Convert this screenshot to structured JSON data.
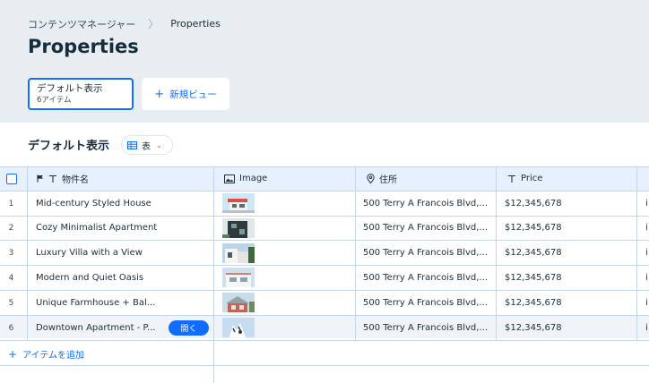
{
  "breadcrumb": {
    "parent": "コンテンツマネージャー",
    "separator": "〉",
    "current": "Properties"
  },
  "page_title": "Properties",
  "views": {
    "active_name": "デフォルト表示",
    "active_count": "6アイテム",
    "new_view": "新規ビュー"
  },
  "section": {
    "title": "デフォルト表示",
    "layout_label": "表"
  },
  "columns": {
    "title": "物件名",
    "image": "Image",
    "address": "住所",
    "price": "Price",
    "next_partial": ""
  },
  "rows": [
    {
      "num": "1",
      "title": "Mid-century Styled House",
      "address": "500 Terry A Francois Blvd,...",
      "price": "$12,345,678",
      "extra": "i"
    },
    {
      "num": "2",
      "title": "Cozy Minimalist Apartment",
      "address": "500 Terry A Francois Blvd,...",
      "price": "$12,345,678",
      "extra": "i"
    },
    {
      "num": "3",
      "title": "Luxury Villa with a View",
      "address": "500 Terry A Francois Blvd,...",
      "price": "$12,345,678",
      "extra": "i"
    },
    {
      "num": "4",
      "title": "Modern and Quiet Oasis",
      "address": "500 Terry A Francois Blvd,...",
      "price": "$12,345,678",
      "extra": "i"
    },
    {
      "num": "5",
      "title": "Unique Farmhouse + Bal...",
      "address": "500 Terry A Francois Blvd,...",
      "price": "$12,345,678",
      "extra": "i"
    },
    {
      "num": "6",
      "title": "Downtown Apartment - P...",
      "address": "500 Terry A Francois Blvd,...",
      "price": "$12,345,678",
      "extra": "i"
    }
  ],
  "open_button": "開く",
  "add_item": "アイテムを追加",
  "colors": {
    "accent": "#116dff",
    "header_bg": "#e8edf2",
    "grid_line": "#c3d6ea",
    "table_header_bg": "#e7f0fe"
  }
}
